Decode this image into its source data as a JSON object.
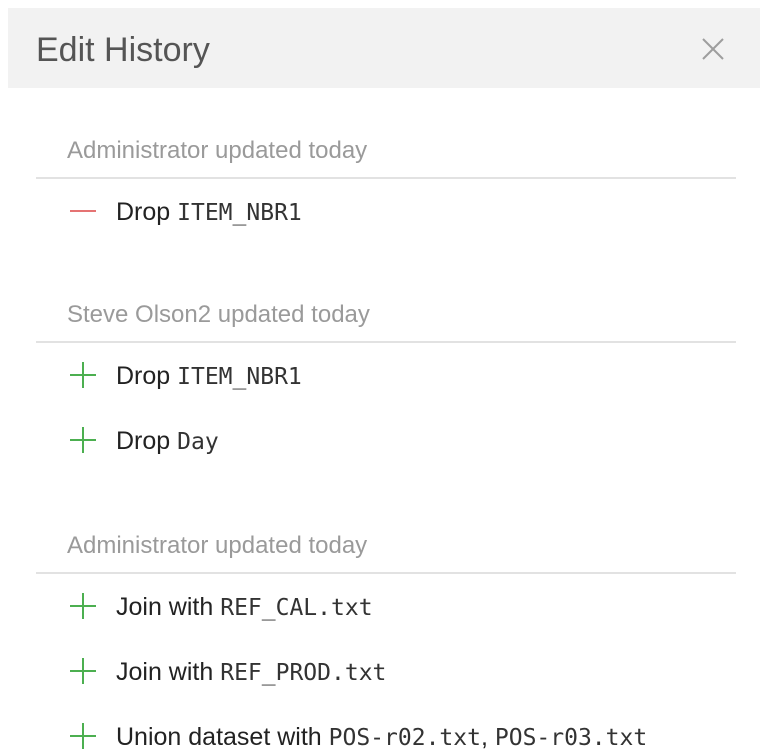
{
  "panel": {
    "title": "Edit History",
    "close_icon": "close-icon"
  },
  "colors": {
    "remove": "#e57373",
    "add": "#4caf50",
    "header_bg": "#f2f2f2"
  },
  "groups": [
    {
      "header": "Administrator updated today",
      "entries": [
        {
          "icon": "minus-icon",
          "verb": "Drop",
          "parts": [
            {
              "code": "ITEM_NBR1"
            }
          ]
        }
      ]
    },
    {
      "header": "Steve Olson2 updated today",
      "entries": [
        {
          "icon": "plus-icon",
          "verb": "Drop",
          "parts": [
            {
              "code": "ITEM_NBR1"
            }
          ]
        },
        {
          "icon": "plus-icon",
          "verb": "Drop",
          "parts": [
            {
              "code": "Day"
            }
          ]
        }
      ]
    },
    {
      "header": "Administrator updated today",
      "entries": [
        {
          "icon": "plus-icon",
          "verb": "Join with",
          "parts": [
            {
              "code": "REF_CAL.txt"
            }
          ]
        },
        {
          "icon": "plus-icon",
          "verb": "Join with",
          "parts": [
            {
              "code": "REF_PROD.txt"
            }
          ]
        },
        {
          "icon": "plus-icon",
          "verb": "Union dataset with",
          "parts": [
            {
              "code": "POS-r02.txt"
            },
            {
              "sep": ", "
            },
            {
              "code": "POS-r03.txt"
            }
          ]
        }
      ]
    }
  ]
}
